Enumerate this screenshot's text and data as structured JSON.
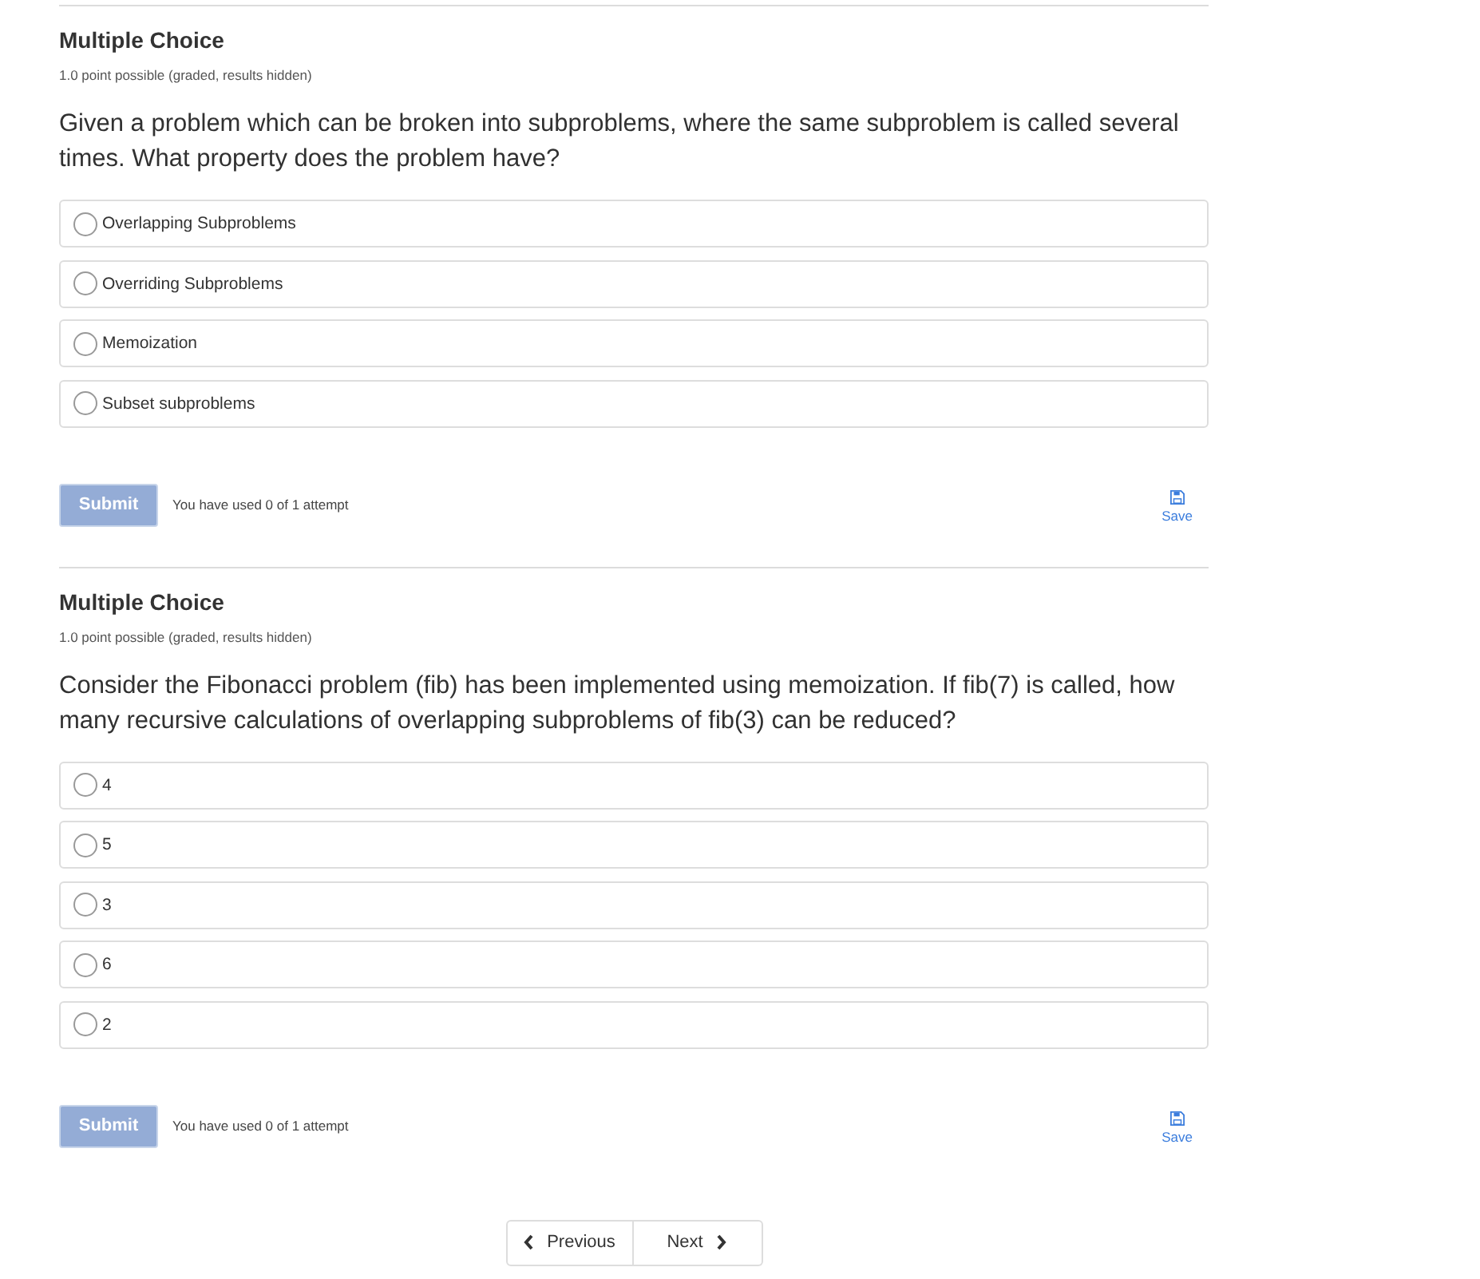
{
  "problems": [
    {
      "title": "Multiple Choice",
      "meta": "1.0 point possible (graded, results hidden)",
      "question": "Given a problem which can be broken into subproblems, where the same subproblem is called several times. What property does the problem have?",
      "options": [
        {
          "label": "Overlapping Subproblems",
          "selected": false
        },
        {
          "label": "Overriding Subproblems",
          "selected": false
        },
        {
          "label": "Memoization",
          "selected": false
        },
        {
          "label": "Subset subproblems",
          "selected": false
        }
      ],
      "submit": {
        "label": "Submit",
        "disabled": true
      },
      "attempts": "You have used 0 of 1 attempt",
      "save": "Save"
    },
    {
      "title": "Multiple Choice",
      "meta": "1.0 point possible (graded, results hidden)",
      "question": "Consider the Fibonacci problem (fib) has been implemented using memoization. If fib(7) is called, how many recursive calculations of overlapping subproblems of fib(3) can be reduced?",
      "options": [
        {
          "label": "4",
          "selected": false
        },
        {
          "label": "5",
          "selected": false
        },
        {
          "label": "3",
          "selected": false
        },
        {
          "label": "6",
          "selected": false
        },
        {
          "label": "2",
          "selected": false
        }
      ],
      "submit": {
        "label": "Submit",
        "disabled": true
      },
      "attempts": "You have used 0 of 1 attempt",
      "save": "Save"
    }
  ],
  "navigation": {
    "previous": "Previous",
    "next": "Next"
  }
}
